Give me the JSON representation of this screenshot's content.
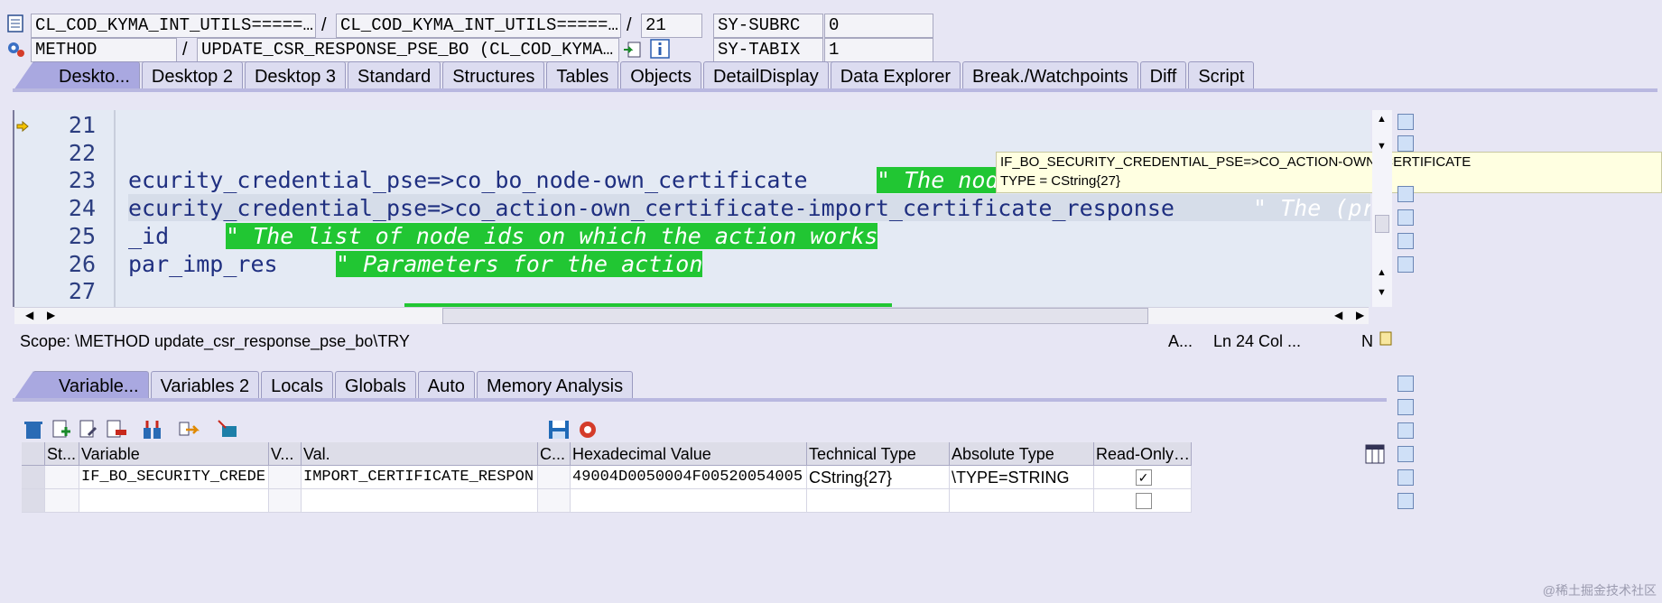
{
  "header": {
    "row1": {
      "program": "CL_COD_KYMA_INT_UTILS========",
      "include": "CL_COD_KYMA_INT_UTILS========",
      "line": "21",
      "sysvar1_name": "SY-SUBRC",
      "sysvar1_value": "0"
    },
    "row2": {
      "event_type": "METHOD",
      "event": "UPDATE_CSR_RESPONSE_PSE_BO (CL_COD_KYMA_INT_UT",
      "sysvar2_name": "SY-TABIX",
      "sysvar2_value": "1"
    },
    "slash": "/"
  },
  "desktop_tabs": [
    "Deskto...",
    "Desktop 2",
    "Desktop 3",
    "Standard",
    "Structures",
    "Tables",
    "Objects",
    "DetailDisplay",
    "Data Explorer",
    "Break./Watchpoints",
    "Diff",
    "Script"
  ],
  "editor": {
    "lines": [
      {
        "num": "21",
        "code": ""
      },
      {
        "num": "22",
        "code": ""
      },
      {
        "num": "23",
        "code": "ecurity_credential_pse=>co_bo_node-own_certificate",
        "comment": "\" The nod"
      },
      {
        "num": "24",
        "code": "ecurity_credential_pse=>co_action-own_certificate-import_certificate_response",
        "comment2": "\" The (pr"
      },
      {
        "num": "25",
        "code": "_id",
        "comment": "\" The list of node ids on which the action works"
      },
      {
        "num": "26",
        "code": "par_imp_res",
        "comment": "\" Parameters for the action"
      },
      {
        "num": "27",
        "code": ""
      }
    ],
    "tooltip": {
      "line1": "IF_BO_SECURITY_CREDENTIAL_PSE=>CO_ACTION-OWN_CERTIFICATE",
      "line2": "TYPE  = CString{27}"
    }
  },
  "status_bar": {
    "scope": "Scope: \\METHOD update_csr_response_pse_bo\\TRY",
    "a": "A...",
    "position": "Ln  24 Col ...",
    "mode": "N"
  },
  "variable_tabs": [
    "Variable...",
    "Variables 2",
    "Locals",
    "Globals",
    "Auto",
    "Memory Analysis"
  ],
  "grid": {
    "columns": [
      "St...",
      "Variable",
      "V...",
      "Val.",
      "C...",
      "Hexadecimal Value",
      "Technical Type",
      "Absolute Type",
      "Read-Only ..."
    ],
    "rows": [
      {
        "status": "",
        "variable": "IF_BO_SECURITY_CREDE",
        "v": "",
        "value": "IMPORT_CERTIFICATE_RESPON",
        "c": "",
        "hex": "49004D0050004F00520054005",
        "technical_type": "CString{27}",
        "absolute_type": "\\TYPE=STRING",
        "read_only": true
      },
      {
        "status": "",
        "variable": "",
        "v": "",
        "value": "",
        "c": "",
        "hex": "",
        "technical_type": "",
        "absolute_type": "",
        "read_only": false
      }
    ]
  },
  "watermark": "@稀土掘金技术社区",
  "colors": {
    "background": "#e7e6f4",
    "active_tab": "#a9a8e0",
    "comment_bg": "#21c633",
    "code_text": "#1f2f80",
    "tooltip_bg": "#ffffe1"
  }
}
